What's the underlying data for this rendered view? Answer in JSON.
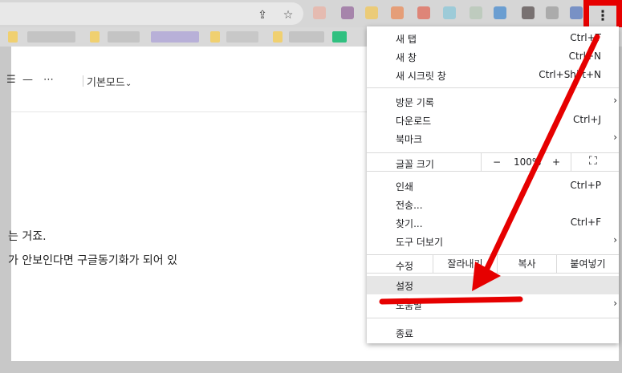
{
  "toolbar": {
    "share_icon": "share-icon",
    "bookmark_star_icon": "star-icon",
    "menu_icon": "more-vert-icon",
    "menu_glyph": "⋮"
  },
  "editor": {
    "align_glyph": "☰",
    "line_glyph": "—",
    "more_glyph": "⋯",
    "mode_label": "기본모드",
    "mode_caret": "⌄"
  },
  "document": {
    "line1": "는 거죠.",
    "line2": "가 안보인다면  구글동기화가 되어 있"
  },
  "menu": {
    "new_tab": {
      "label": "새 탭",
      "shortcut": "Ctrl+T"
    },
    "new_window": {
      "label": "새 창",
      "shortcut": "Ctrl+N"
    },
    "incognito": {
      "label": "새 시크릿 창",
      "shortcut": "Ctrl+Shift+N"
    },
    "history": {
      "label": "방문 기록"
    },
    "downloads": {
      "label": "다운로드",
      "shortcut": "Ctrl+J"
    },
    "bookmarks": {
      "label": "북마크"
    },
    "zoom": {
      "label": "글꼴 크기",
      "minus": "−",
      "value": "100%",
      "plus": "+",
      "fullscreen_icon": "fullscreen-icon",
      "fullscreen_glyph": "⛶"
    },
    "print": {
      "label": "인쇄",
      "shortcut": "Ctrl+P"
    },
    "cast": {
      "label": "전송..."
    },
    "find": {
      "label": "찾기...",
      "shortcut": "Ctrl+F"
    },
    "more_tools": {
      "label": "도구 더보기"
    },
    "edit": {
      "label": "수정",
      "cut": "잘라내기",
      "copy": "복사",
      "paste": "붙여넣기"
    },
    "settings": {
      "label": "설정"
    },
    "help": {
      "label": "도움말"
    },
    "exit": {
      "label": "종료"
    },
    "submenu_arrow": "›"
  },
  "colors": {
    "annotation_red": "#e60000",
    "menu_highlight": "#e6e6e6"
  }
}
